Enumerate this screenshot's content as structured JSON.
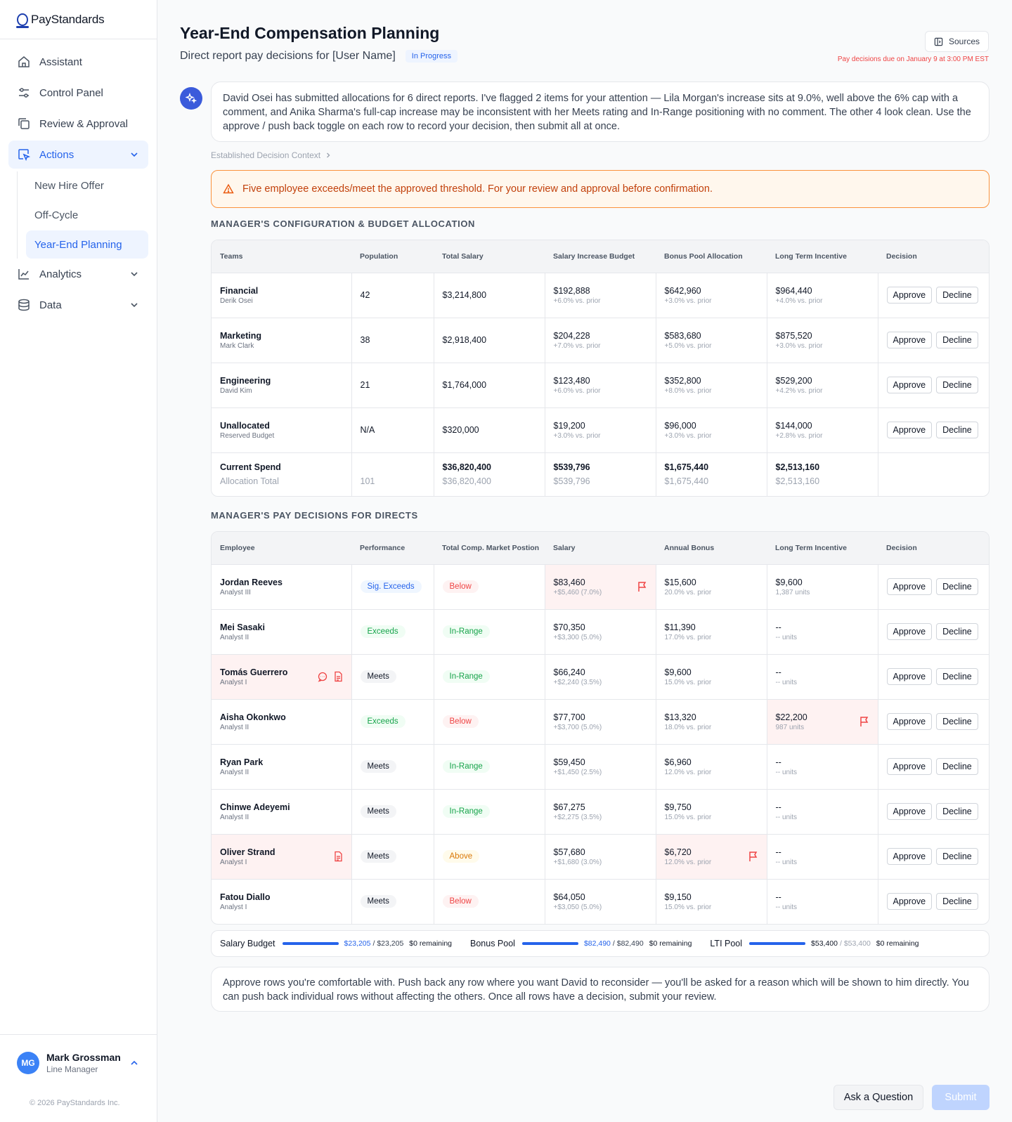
{
  "brand": {
    "name": "PayStandards"
  },
  "nav": {
    "items": [
      {
        "label": "Assistant"
      },
      {
        "label": "Control Panel"
      },
      {
        "label": "Review & Approval"
      },
      {
        "label": "Actions"
      },
      {
        "label": "Analytics"
      },
      {
        "label": "Data"
      }
    ],
    "actions_sub": [
      {
        "label": "New Hire Offer"
      },
      {
        "label": "Off-Cycle"
      },
      {
        "label": "Year-End Planning"
      }
    ]
  },
  "user": {
    "initials": "MG",
    "name": "Mark Grossman",
    "role": "Line Manager"
  },
  "copyright": "© 2026 PayStandards Inc.",
  "header": {
    "title": "Year-End Compensation Planning",
    "subtitle": "Direct report pay decisions for [User Name]",
    "status": "In Progress",
    "sources_label": "Sources",
    "due": "Pay decisions due on January 9 at 3:00 PM EST"
  },
  "assistant_message": "David Osei has submitted allocations for 6 direct reports. I've flagged 2 items for your attention — Lila Morgan's increase sits at 9.0%, well above the 6% cap with a comment, and Anika Sharma's full-cap increase may be inconsistent with her Meets rating and In-Range positioning with no comment. The other 4 look clean. Use the approve / push back toggle on each row to record your decision, then submit all at once.",
  "context_link": "Established Decision Context",
  "warning": "Five employee exceeds/meet the approved threshold. For your review and approval before confirmation.",
  "config": {
    "section_title": "MANAGER'S CONFIGURATION & BUDGET ALLOCATION",
    "headers": [
      "Teams",
      "Population",
      "Total Salary",
      "Salary Increase Budget",
      "Bonus Pool Allocation",
      "Long Term Incentive",
      "Decision"
    ],
    "rows": [
      {
        "team": "Financial",
        "lead": "Derik Osei",
        "population": "42",
        "total_salary": "$3,214,800",
        "salary_budget": "$192,888",
        "salary_budget_delta": "+6.0% vs. prior",
        "bonus": "$642,960",
        "bonus_delta": "+3.0% vs. prior",
        "lti": "$964,440",
        "lti_delta": "+4.0% vs. prior"
      },
      {
        "team": "Marketing",
        "lead": "Mark Clark",
        "population": "38",
        "total_salary": "$2,918,400",
        "salary_budget": "$204,228",
        "salary_budget_delta": "+7.0% vs. prior",
        "bonus": "$583,680",
        "bonus_delta": "+5.0% vs. prior",
        "lti": "$875,520",
        "lti_delta": "+3.0% vs. prior"
      },
      {
        "team": "Engineering",
        "lead": "David Kim",
        "population": "21",
        "total_salary": "$1,764,000",
        "salary_budget": "$123,480",
        "salary_budget_delta": "+6.0% vs. prior",
        "bonus": "$352,800",
        "bonus_delta": "+8.0% vs. prior",
        "lti": "$529,200",
        "lti_delta": "+4.2% vs. prior"
      },
      {
        "team": "Unallocated",
        "lead": "Reserved Budget",
        "population": "N/A",
        "total_salary": "$320,000",
        "salary_budget": "$19,200",
        "salary_budget_delta": "+3.0% vs. prior",
        "bonus": "$96,000",
        "bonus_delta": "+3.0% vs. prior",
        "lti": "$144,000",
        "lti_delta": "+2.8% vs. prior"
      }
    ],
    "totals": {
      "label": "Current Spend",
      "sub_label": "Allocation Total",
      "population": "101",
      "total_salary": "$36,820,400",
      "total_salary_alloc": "$36,820,400",
      "salary_budget": "$539,796",
      "salary_budget_alloc": "$539,796",
      "bonus": "$1,675,440",
      "bonus_alloc": "$1,675,440",
      "lti": "$2,513,160",
      "lti_alloc": "$2,513,160"
    }
  },
  "directs": {
    "section_title": "MANAGER'S PAY DECISIONS FOR DIRECTS",
    "headers": [
      "Employee",
      "Performance",
      "Total Comp. Market Postion",
      "Salary",
      "Annual Bonus",
      "Long Term Incentive",
      "Decision"
    ],
    "rows": [
      {
        "name": "Jordan Reeves",
        "role": "Analyst III",
        "performance": "Sig. Exceeds",
        "perf_style": "blue",
        "market": "Below",
        "market_style": "red",
        "salary": "$83,460",
        "salary_delta": "+$5,460 (7.0%)",
        "bonus": "$15,600",
        "bonus_delta": "20.0% vs. prior",
        "lti": "$9,600",
        "lti_units": "1,387 units",
        "flag_salary": true
      },
      {
        "name": "Mei Sasaki",
        "role": "Analyst II",
        "performance": "Exceeds",
        "perf_style": "green",
        "market": "In-Range",
        "market_style": "green",
        "salary": "$70,350",
        "salary_delta": "+$3,300 (5.0%)",
        "bonus": "$11,390",
        "bonus_delta": "17.0% vs. prior",
        "lti": "--",
        "lti_units": "-- units"
      },
      {
        "name": "Tomás Guerrero",
        "role": "Analyst I",
        "performance": "Meets",
        "perf_style": "gray",
        "market": "In-Range",
        "market_style": "green",
        "salary": "$66,240",
        "salary_delta": "+$2,240 (3.5%)",
        "bonus": "$9,600",
        "bonus_delta": "15.0% vs. prior",
        "lti": "--",
        "lti_units": "-- units",
        "flag_name": true
      },
      {
        "name": "Aisha Okonkwo",
        "role": "Analyst II",
        "performance": "Exceeds",
        "perf_style": "green",
        "market": "Below",
        "market_style": "red",
        "salary": "$77,700",
        "salary_delta": "+$3,700 (5.0%)",
        "bonus": "$13,320",
        "bonus_delta": "18.0% vs. prior",
        "lti": "$22,200",
        "lti_units": "987 units",
        "flag_lti": true
      },
      {
        "name": "Ryan Park",
        "role": "Analyst II",
        "performance": "Meets",
        "perf_style": "gray",
        "market": "In-Range",
        "market_style": "green",
        "salary": "$59,450",
        "salary_delta": "+$1,450 (2.5%)",
        "bonus": "$6,960",
        "bonus_delta": "12.0% vs. prior",
        "lti": "--",
        "lti_units": "-- units"
      },
      {
        "name": "Chinwe Adeyemi",
        "role": "Analyst II",
        "performance": "Meets",
        "perf_style": "gray",
        "market": "In-Range",
        "market_style": "green",
        "salary": "$67,275",
        "salary_delta": "+$2,275 (3.5%)",
        "bonus": "$9,750",
        "bonus_delta": "15.0% vs. prior",
        "lti": "--",
        "lti_units": "-- units"
      },
      {
        "name": "Oliver Strand",
        "role": "Analyst I",
        "performance": "Meets",
        "perf_style": "gray",
        "market": "Above",
        "market_style": "amber",
        "salary": "$57,680",
        "salary_delta": "+$1,680 (3.0%)",
        "bonus": "$6,720",
        "bonus_delta": "12.0% vs. prior",
        "lti": "--",
        "lti_units": "-- units",
        "flag_name_doc": true,
        "flag_bonus": true
      },
      {
        "name": "Fatou Diallo",
        "role": "Analyst I",
        "performance": "Meets",
        "perf_style": "gray",
        "market": "Below",
        "market_style": "red",
        "salary": "$64,050",
        "salary_delta": "+$3,050 (5.0%)",
        "bonus": "$9,150",
        "bonus_delta": "15.0% vs. prior",
        "lti": "--",
        "lti_units": "-- units"
      }
    ]
  },
  "decision_labels": {
    "approve": "Approve",
    "decline": "Decline"
  },
  "budget": {
    "salary": {
      "label": "Salary Budget",
      "current": "$23,205",
      "total": "/ $23,205",
      "remaining": "$0 remaining",
      "fill_fraction": 1.0
    },
    "bonus": {
      "label": "Bonus Pool",
      "current": "$82,490",
      "total": "/ $82,490",
      "remaining": "$0 remaining",
      "fill_fraction": 1.0
    },
    "lti": {
      "label": "LTI Pool",
      "current": "$53,400",
      "total": "/ $53,400",
      "remaining": "$0 remaining",
      "fill_fraction": 1.0
    }
  },
  "note": "Approve rows you're comfortable with. Push back any row where you want David to reconsider — you'll be asked for a reason which will be shown to him directly. You can push back individual rows without affecting the others. Once all rows have a decision, submit your review.",
  "footer": {
    "ask_label": "Ask a Question",
    "submit_label": "Submit"
  },
  "colors": {
    "accent": "#2563eb",
    "warning": "#fb923c",
    "danger": "#ef4444",
    "flag_bg": "#fef2f2"
  }
}
